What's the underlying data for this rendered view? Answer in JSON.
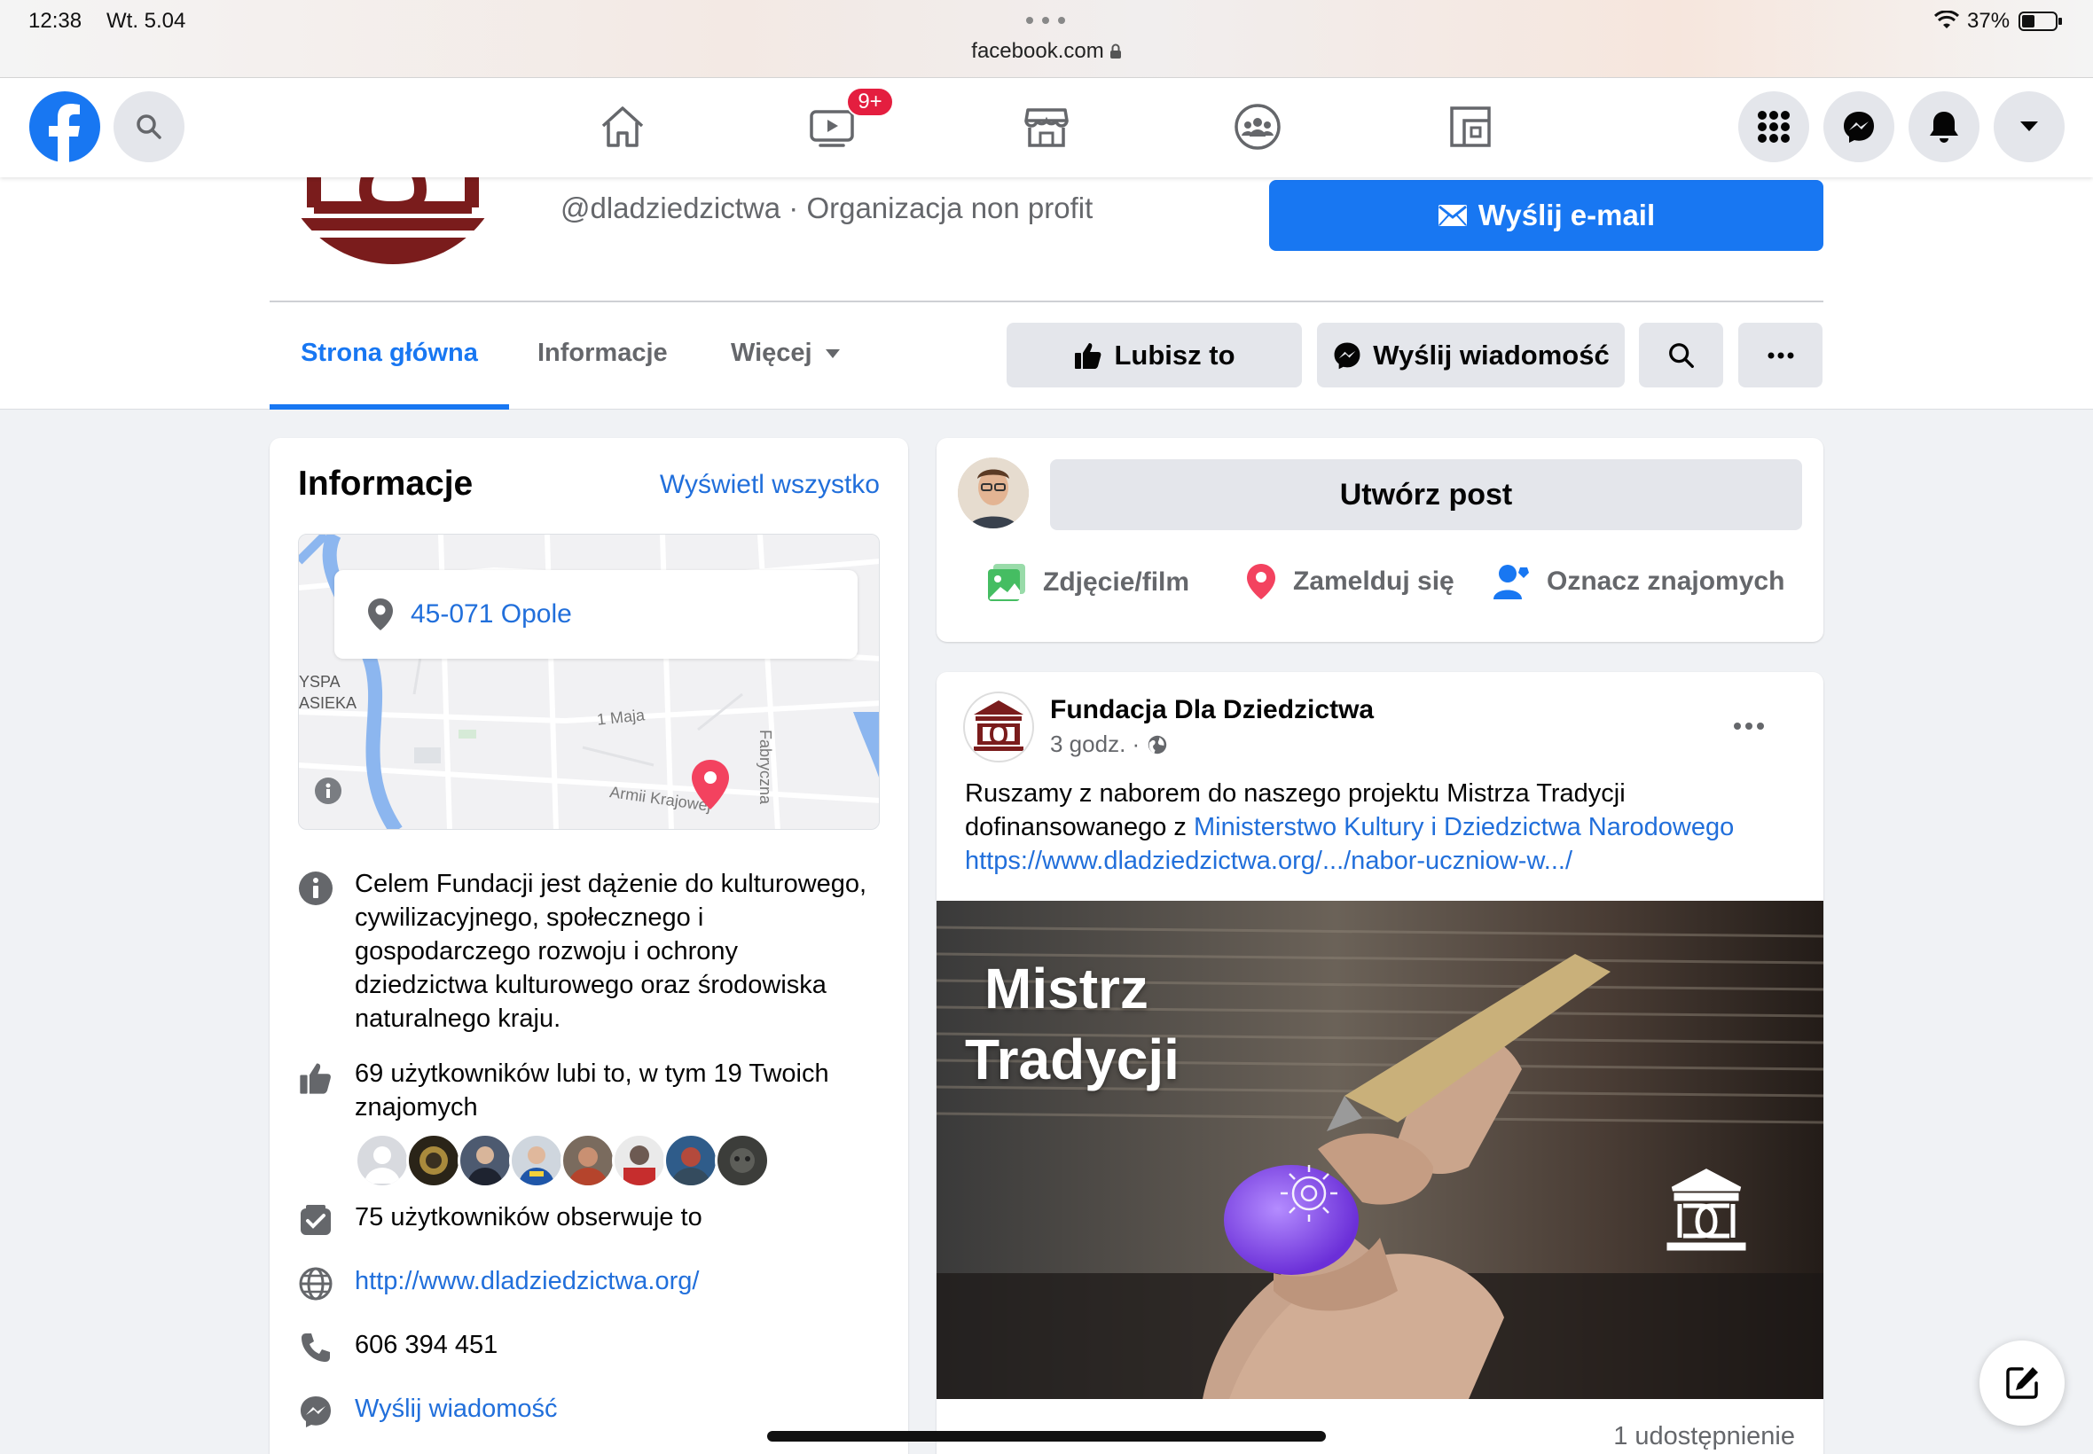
{
  "status_bar": {
    "time": "12:38",
    "date": "Wt. 5.04",
    "url": "facebook.com",
    "battery": "37%"
  },
  "topbar": {
    "video_badge": "9+"
  },
  "profile": {
    "handle_line": "@dladziedzictwa · Organizacja non profit",
    "email_button": "Wyślij e-mail",
    "tabs": [
      "Strona główna",
      "Informacje",
      "Więcej"
    ],
    "like_button": "Lubisz to",
    "message_button": "Wyślij wiadomość"
  },
  "info_card": {
    "title": "Informacje",
    "see_all": "Wyświetl wszystko",
    "map": {
      "location": "45-071 Opole",
      "labels": [
        "YSPA",
        "ASIEKA",
        "1 Maja",
        "Fabryczna",
        "Armii Krajowej"
      ]
    },
    "about": "Celem Fundacji jest dążenie do kulturowego, cywilizacyjnego, społecznego i gospodarczego rozwoju i ochrony dziedzictwa kulturowego oraz środowiska naturalnego kraju.",
    "likes": "69 użytkowników lubi to, w tym 19 Twoich znajomych",
    "followers": "75 użytkowników obserwuje to",
    "website": "http://www.dladziedzictwa.org/",
    "phone": "606 394 451",
    "send_message": "Wyślij wiadomość"
  },
  "create_post": {
    "button": "Utwórz post",
    "actions": [
      "Zdjęcie/film",
      "Zamelduj się",
      "Oznacz znajomych"
    ],
    "colors": {
      "photo": "#45bd62",
      "checkin": "#f3425f",
      "tag": "#1877f2"
    }
  },
  "post": {
    "author": "Fundacja Dla Dziedzictwa",
    "time": "3 godz. ·",
    "text_1": "Ruszamy z naborem do naszego projektu Mistrza Tradycji",
    "text_2": "dofinansowanego z",
    "text_link": "Ministerstwo Kultury i Dziedzictwa Narodowego",
    "url": "https://www.dladziedzictwa.org/.../nabor-uczniow-w.../",
    "image_title_1": "Mistrz",
    "image_title_2": "Tradycji",
    "shares": "1 udostępnienie"
  },
  "colors": {
    "accent": "#216fdb",
    "brand": "#1877f2",
    "badge": "#e41e3f",
    "logo_red": "#7a1c1c"
  }
}
